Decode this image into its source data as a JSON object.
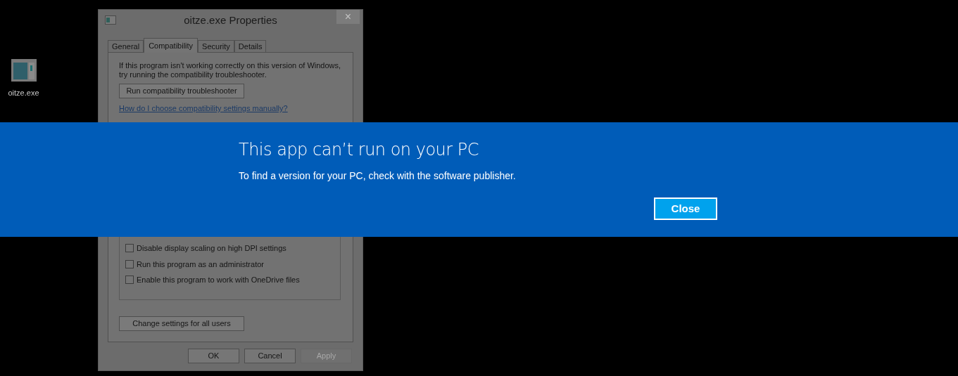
{
  "desktop_icon": {
    "label": "oitze.exe"
  },
  "dialog": {
    "title": "oitze.exe Properties",
    "close": "×",
    "tabs": [
      {
        "label": "General",
        "selected": false
      },
      {
        "label": "Compatibility",
        "selected": true
      },
      {
        "label": "Security",
        "selected": false
      },
      {
        "label": "Details",
        "selected": false
      }
    ],
    "intro": "If this program isn't working correctly on this version of Windows, try running the compatibility troubleshooter.",
    "troubleshooter_button": "Run compatibility troubleshooter",
    "help_link": "How do I choose compatibility settings manually?",
    "checkboxes": [
      {
        "label": "Disable display scaling on high DPI settings",
        "checked": false
      },
      {
        "label": "Run this program as an administrator",
        "checked": false
      },
      {
        "label": "Enable this program to work with OneDrive files",
        "checked": false
      }
    ],
    "all_users_button": "Change settings for all users",
    "buttons": [
      {
        "label": "OK",
        "disabled": false
      },
      {
        "label": "Cancel",
        "disabled": false
      },
      {
        "label": "Apply",
        "disabled": true
      }
    ]
  },
  "banner": {
    "title": "This app can’t run on your PC",
    "message": "To find a version for your PC, check with the software publisher.",
    "button": "Close"
  }
}
